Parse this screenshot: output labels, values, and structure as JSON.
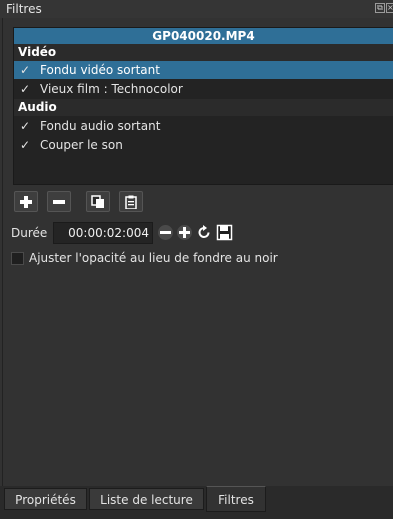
{
  "window": {
    "title": "Filtres"
  },
  "filter_list": {
    "file_name": "GP040020.MP4",
    "sections": [
      {
        "label": "Vidéo",
        "items": [
          {
            "label": "Fondu vidéo sortant",
            "checked": true,
            "selected": true
          },
          {
            "label": "Vieux film : Technocolor",
            "checked": true,
            "selected": false
          }
        ]
      },
      {
        "label": "Audio",
        "items": [
          {
            "label": "Fondu audio sortant",
            "checked": true,
            "selected": false
          },
          {
            "label": "Couper le son",
            "checked": true,
            "selected": false
          }
        ]
      }
    ],
    "check_glyph": "✓"
  },
  "toolbar": {
    "buttons": [
      "add-icon",
      "remove-icon",
      "copy-icon",
      "paste-icon"
    ]
  },
  "duration": {
    "label": "Durée",
    "value": "00:00:02:004"
  },
  "option": {
    "label": "Ajuster l'opacité au lieu de fondre au noir",
    "checked": false
  },
  "tabs": [
    {
      "label": "Propriétés",
      "active": false
    },
    {
      "label": "Liste de lecture",
      "active": false
    },
    {
      "label": "Filtres",
      "active": true
    }
  ],
  "colors": {
    "selection": "#2f6f97",
    "background": "#323232"
  }
}
